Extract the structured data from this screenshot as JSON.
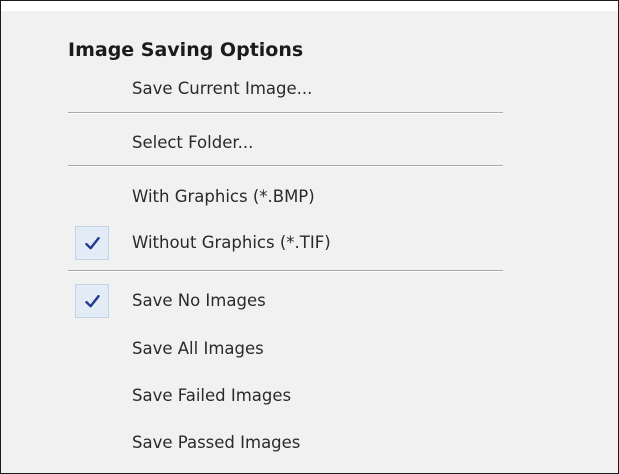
{
  "menu": {
    "heading": "Image Saving Options",
    "items": [
      {
        "label": "Save Current Image...",
        "checked": false
      },
      {
        "label": "Select Folder...",
        "checked": false
      },
      {
        "label": "With Graphics (*.BMP)",
        "checked": false
      },
      {
        "label": "Without Graphics (*.TIF)",
        "checked": true
      },
      {
        "label": "Save No Images",
        "checked": true
      },
      {
        "label": "Save All Images",
        "checked": false
      },
      {
        "label": "Save Failed Images",
        "checked": false
      },
      {
        "label": "Save Passed Images",
        "checked": false
      }
    ]
  },
  "icons": {
    "check": "checkmark-icon"
  },
  "colors": {
    "menu_background": "#f1f1f1",
    "check_highlight": "#e3ecf6",
    "check_mark": "#1f3a8f",
    "separator": "#a9a9a9"
  }
}
